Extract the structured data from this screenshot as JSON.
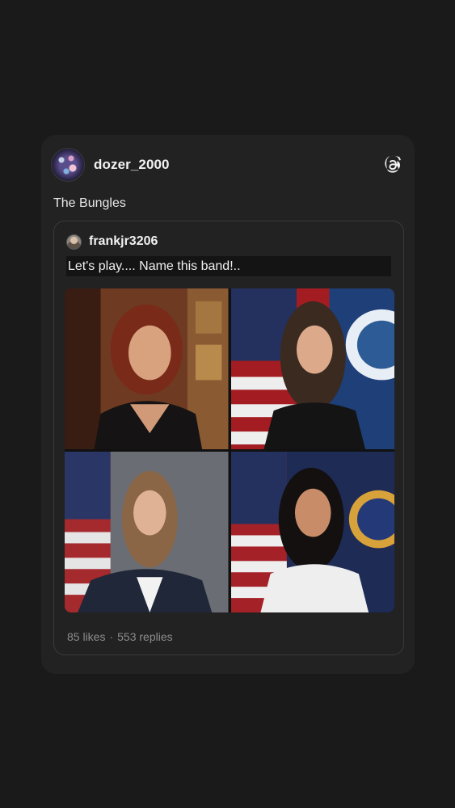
{
  "post": {
    "username": "dozer_2000",
    "caption": "The Bungles",
    "avatar_icon": "avatar-icon",
    "logo_icon": "threads-logo-icon"
  },
  "quoted_post": {
    "username": "frankjr3206",
    "text": "Let's play.... Name this band!..",
    "photos": [
      {
        "icon": "portrait-photo-1"
      },
      {
        "icon": "portrait-photo-2"
      },
      {
        "icon": "portrait-photo-3"
      },
      {
        "icon": "portrait-photo-4"
      }
    ],
    "likes": "85 likes",
    "separator": "·",
    "replies": "553 replies"
  },
  "colors": {
    "background": "#1a1a1a",
    "card": "#222223",
    "text_primary": "#f2f2f2",
    "text_secondary": "#8c8c8c"
  }
}
